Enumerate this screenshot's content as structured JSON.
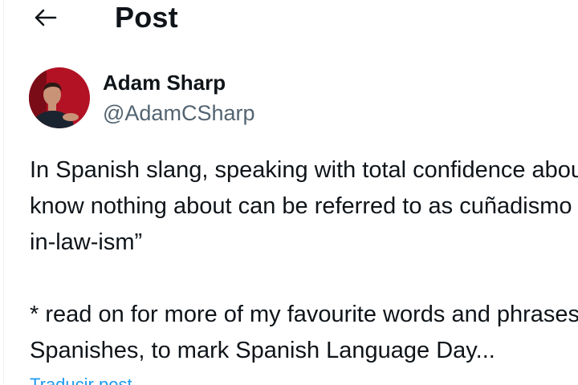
{
  "header": {
    "back_icon": "arrow-left-icon",
    "title": "Post"
  },
  "post": {
    "author": {
      "name": "Adam Sharp",
      "handle": "@AdamCSharp",
      "avatar_colors": {
        "background": "#b31224",
        "skin": "#c99378",
        "hair": "#2b1a14",
        "shirt": "#1a2430"
      }
    },
    "body_lines": [
      "In Spanish slang, speaking with total confidence about things you",
      "know nothing about can be referred to as cuñadismo - “brother-",
      "in-law-ism”",
      "",
      "* read on for more of my favourite words and phrases across the",
      "Spanishes, to mark Spanish Language Day..."
    ],
    "translate_label": "Traducir post"
  },
  "colors": {
    "text": "#0f1419",
    "secondary_text": "#536471",
    "link": "#1d9bf0"
  }
}
